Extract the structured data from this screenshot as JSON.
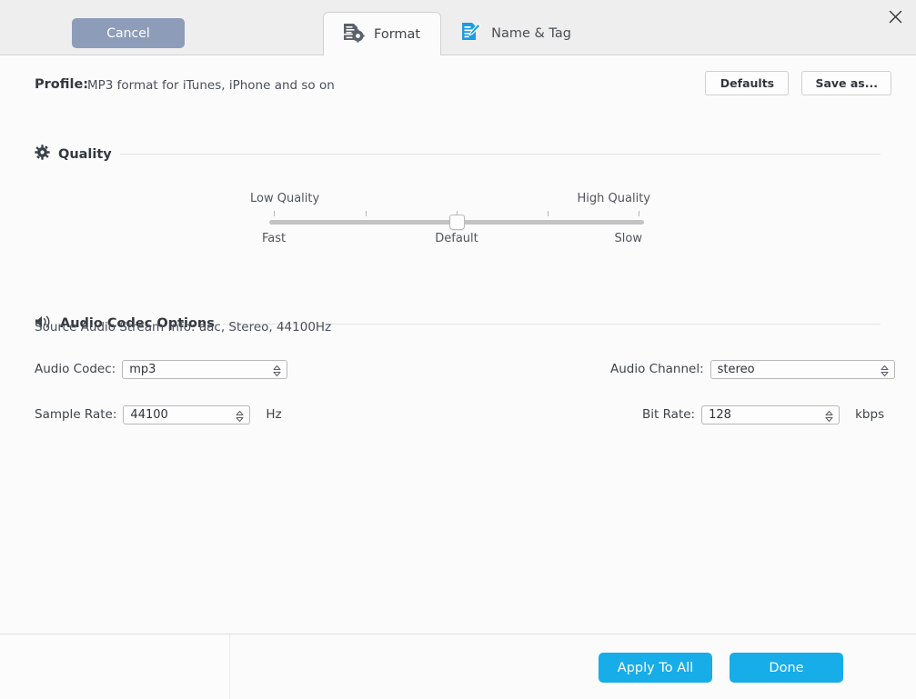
{
  "window": {
    "close_icon": "close-icon"
  },
  "tabs": [
    {
      "id": "format",
      "label": "Format",
      "icon": "document-gear-icon",
      "active": true
    },
    {
      "id": "name_tag",
      "label": "Name & Tag",
      "icon": "document-pencil-icon",
      "active": false
    }
  ],
  "profile": {
    "label": "Profile:",
    "value": "MP3 format for iTunes, iPhone and so on",
    "defaults_button": "Defaults",
    "save_as_button": "Save as..."
  },
  "quality": {
    "title": "Quality",
    "icon": "gear-icon",
    "left_caption": "Low Quality",
    "right_caption": "High Quality",
    "left_subcaption": "Fast",
    "center_subcaption": "Default",
    "right_subcaption": "Slow",
    "tick_count": 5,
    "value_percent": 50
  },
  "audio_codec_options": {
    "title": "Audio Codec Options",
    "icon": "speaker-icon",
    "stream_info": "Source Audio Stream Info: aac, Stereo, 44100Hz",
    "fields": {
      "audio_codec": {
        "label": "Audio Codec:",
        "value": "mp3",
        "unit": ""
      },
      "audio_channel": {
        "label": "Audio Channel:",
        "value": "stereo",
        "unit": ""
      },
      "sample_rate": {
        "label": "Sample Rate:",
        "value": "44100",
        "unit": "Hz"
      },
      "bit_rate": {
        "label": "Bit Rate:",
        "value": "128",
        "unit": "kbps"
      }
    }
  },
  "footer": {
    "cancel_button": "Cancel",
    "apply_to_all_button": "Apply To All",
    "done_button": "Done"
  },
  "colors": {
    "accent_blue": "#17ade8",
    "cancel_gray": "#8d9cb8",
    "tab_icon_blue": "#1b9de0",
    "tab_icon_gray": "#5b616b"
  }
}
